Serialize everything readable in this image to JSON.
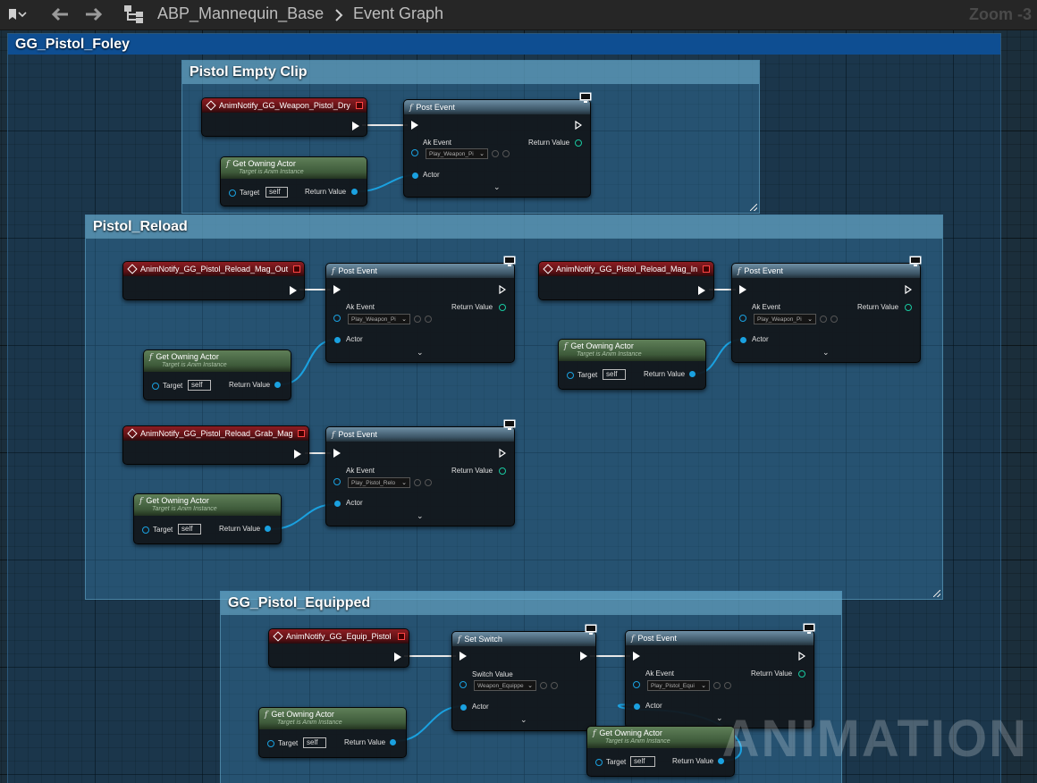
{
  "toolbar": {
    "breadcrumb_blueprint": "ABP_Mannequin_Base",
    "breadcrumb_graph": "Event Graph",
    "zoom": "Zoom -3"
  },
  "comments": {
    "outer": "GG_Pistol_Foley",
    "empty_clip": "Pistol Empty Clip",
    "reload": "Pistol_Reload",
    "equipped": "GG_Pistol_Equipped"
  },
  "nodes": {
    "notify_dry": "AnimNotify_GG_Weapon_Pistol_Dry",
    "notify_mag_out": "AnimNotify_GG_Pistol_Reload_Mag_Out",
    "notify_mag_in": "AnimNotify_GG_Pistol_Reload_Mag_In",
    "notify_grab_mag": "AnimNotify_GG_Pistol_Reload_Grab_Mag",
    "notify_equip": "AnimNotify_GG_Equip_Pistol",
    "post_event": "Post Event",
    "set_switch": "Set Switch",
    "get_owning_actor": "Get Owning Actor",
    "target_is_anim_instance": "Target is Anim Instance",
    "ak_event": "Ak Event",
    "switch_value": "Switch Value",
    "return_value": "Return Value",
    "actor": "Actor",
    "target": "Target",
    "self": "self",
    "ak_values": {
      "dry": "Play_Weapon_Pi",
      "mag_out": "Play_Weapon_Pi",
      "mag_in": "Play_Weapon_Pi",
      "grab_mag": "Play_Pistol_Relo",
      "equip": "Play_Pistol_Equi",
      "switch": "Weapon_Equippe"
    }
  },
  "watermark": "ANIMATION",
  "colors": {
    "event_header": "#8d1d22",
    "function_header": "#3c5566",
    "pure_header": "#3e5a3a",
    "object_pin": "#1aa1e0",
    "comment_header": "#0e4e92"
  }
}
